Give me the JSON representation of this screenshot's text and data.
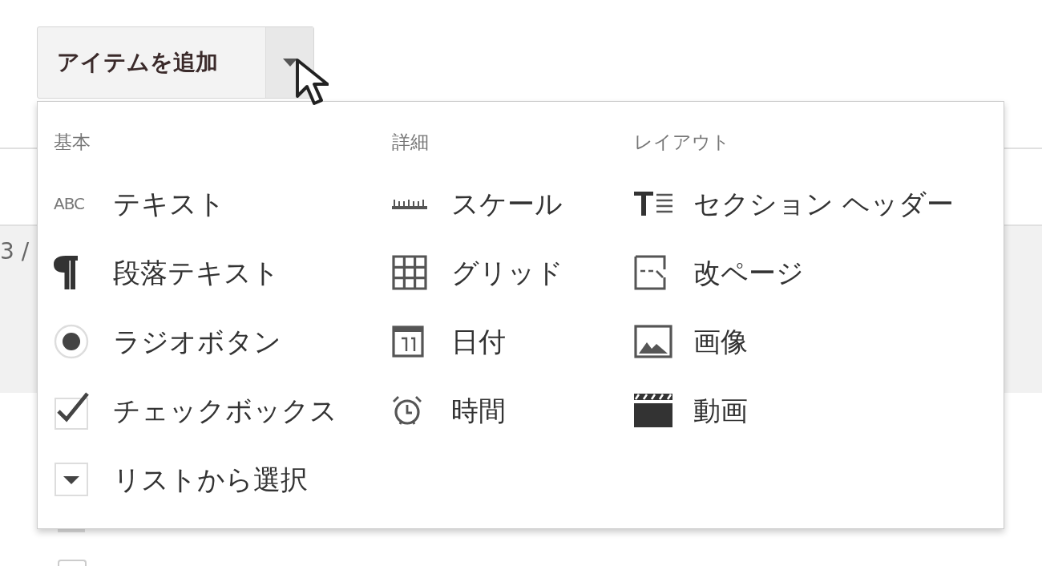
{
  "add_item_button": {
    "label": "アイテムを追加"
  },
  "background": {
    "page_counter": "3 /"
  },
  "menu": {
    "columns": [
      {
        "header": "基本",
        "items": [
          {
            "kind": "text",
            "icon_text": "ABC",
            "label": "テキスト"
          },
          {
            "kind": "paragraph",
            "label": "段落テキスト"
          },
          {
            "kind": "radio",
            "label": "ラジオボタン"
          },
          {
            "kind": "checkbox",
            "label": "チェックボックス"
          },
          {
            "kind": "list",
            "label": "リストから選択"
          }
        ]
      },
      {
        "header": "詳細",
        "items": [
          {
            "kind": "scale",
            "label": "スケール"
          },
          {
            "kind": "grid",
            "label": "グリッド"
          },
          {
            "kind": "date",
            "label": "日付"
          },
          {
            "kind": "time",
            "label": "時間"
          }
        ]
      },
      {
        "header": "レイアウト",
        "items": [
          {
            "kind": "section",
            "label": "セクション ヘッダー"
          },
          {
            "kind": "pagebreak",
            "label": "改ページ"
          },
          {
            "kind": "image",
            "label": "画像"
          },
          {
            "kind": "video",
            "label": "動画"
          }
        ]
      }
    ]
  }
}
